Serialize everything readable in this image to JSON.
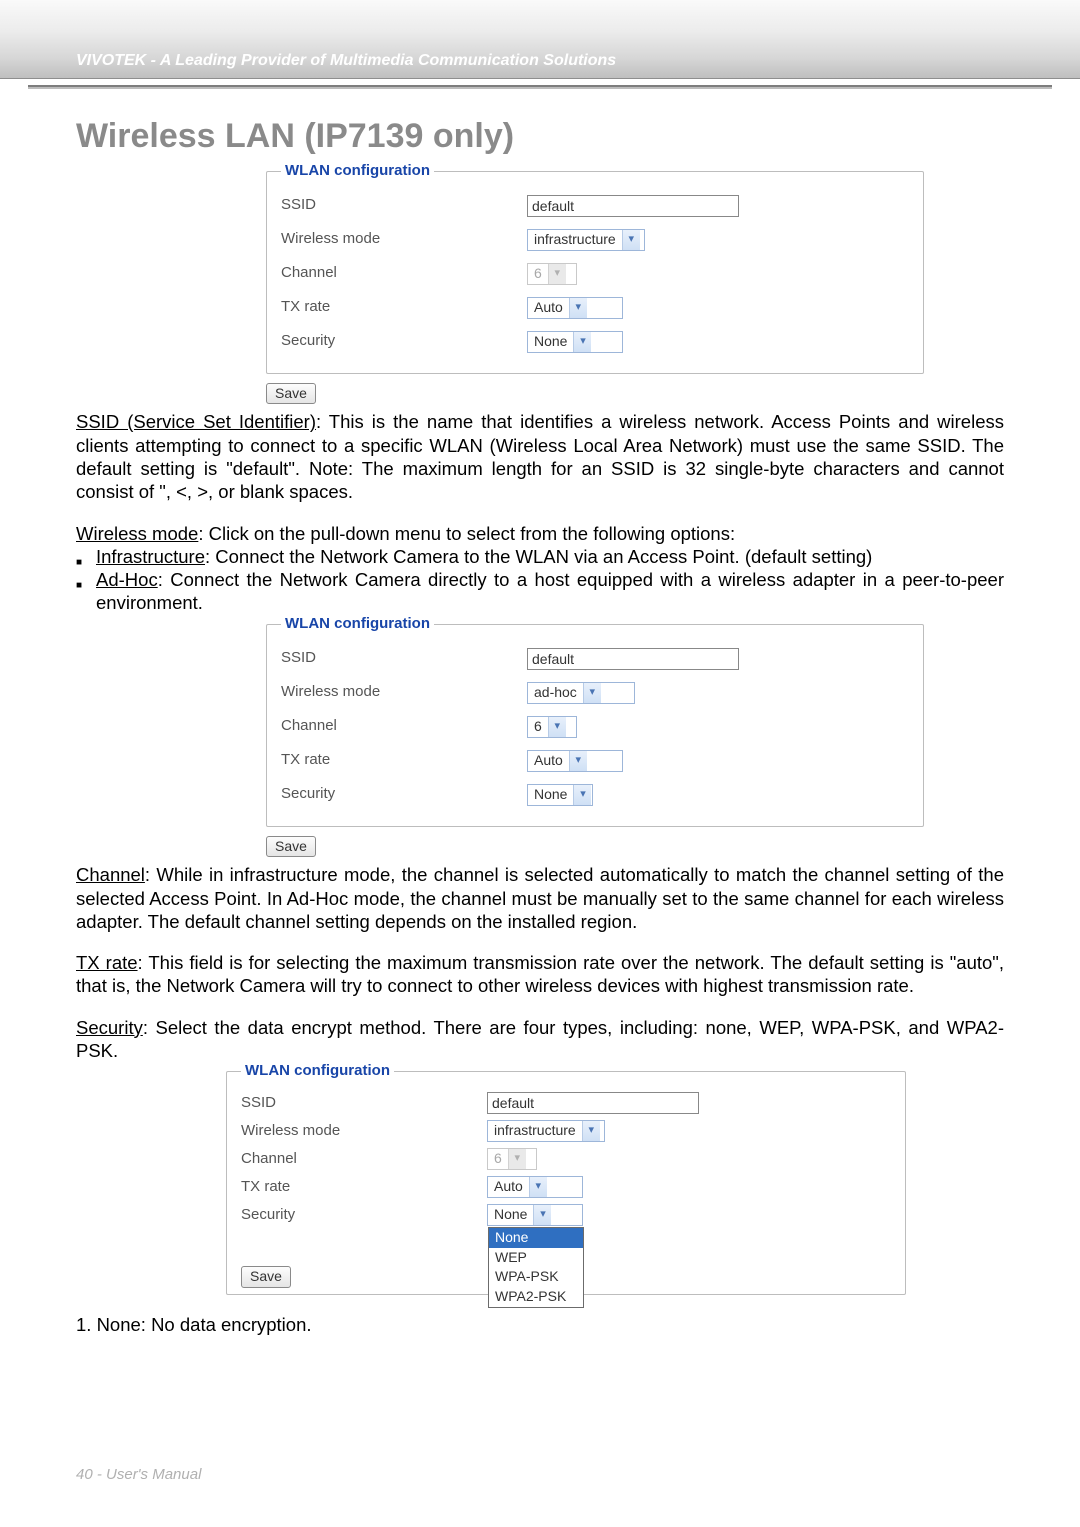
{
  "header": {
    "brand_line": "VIVOTEK - A Leading Provider of Multimedia Communication Solutions"
  },
  "section_title": "Wireless LAN (IP7139 only)",
  "labels": {
    "wlan_legend": "WLAN configuration",
    "ssid": "SSID",
    "wireless_mode": "Wireless mode",
    "channel": "Channel",
    "tx_rate": "TX rate",
    "security": "Security",
    "save": "Save"
  },
  "panel1": {
    "ssid_value": "default",
    "mode_value": "infrastructure",
    "channel_value": "6",
    "txrate_value": "Auto",
    "security_value": "None"
  },
  "panel2": {
    "ssid_value": "default",
    "mode_value": "ad-hoc",
    "channel_value": "6",
    "txrate_value": "Auto",
    "security_value": "None"
  },
  "panel3": {
    "ssid_value": "default",
    "mode_value": "infrastructure",
    "channel_value": "6",
    "txrate_value": "Auto",
    "security_value": "None",
    "security_options": [
      "None",
      "WEP",
      "WPA-PSK",
      "WPA2-PSK"
    ]
  },
  "text": {
    "ssid_label": "SSID (Service Set Identifier)",
    "ssid_body": ": This is the name that identifies a wireless network. Access Points and wireless clients attempting to connect to a specific WLAN (Wireless Local Area Network) must use the same SSID. The default setting is \"default\". Note: The maximum length for an SSID is 32 single-byte characters and cannot consist of \", <, >, or blank spaces.",
    "wm_label": "Wireless mode",
    "wm_body": ": Click on the pull-down menu to select from the following options:",
    "infra_label": "Infrastructure",
    "infra_body": ": Connect the Network Camera to the WLAN via an Access Point. (default setting)",
    "adhoc_label": "Ad-Hoc",
    "adhoc_body": ": Connect the Network Camera directly to a host equipped with a wireless adapter in a peer-to-peer environment.",
    "channel_label": "Channel",
    "channel_body": ": While in infrastructure mode, the channel is selected automatically to match the channel setting of the selected Access Point. In Ad-Hoc mode, the channel must be manually set to the same channel for each wireless adapter. The default channel setting depends on the installed region.",
    "txrate_label": "TX rate",
    "txrate_body": ": This field is for selecting the maximum transmission rate over the network. The default setting is \"auto\", that is, the Network Camera will try to connect to other wireless devices with highest transmission rate.",
    "security_label": "Security",
    "security_body": ": Select the data encrypt method. There are four types, including: none, WEP, WPA-PSK, and WPA2-PSK.",
    "none_item": "1. None: No data encryption."
  },
  "footer": {
    "page_label": "40 - User's Manual"
  }
}
